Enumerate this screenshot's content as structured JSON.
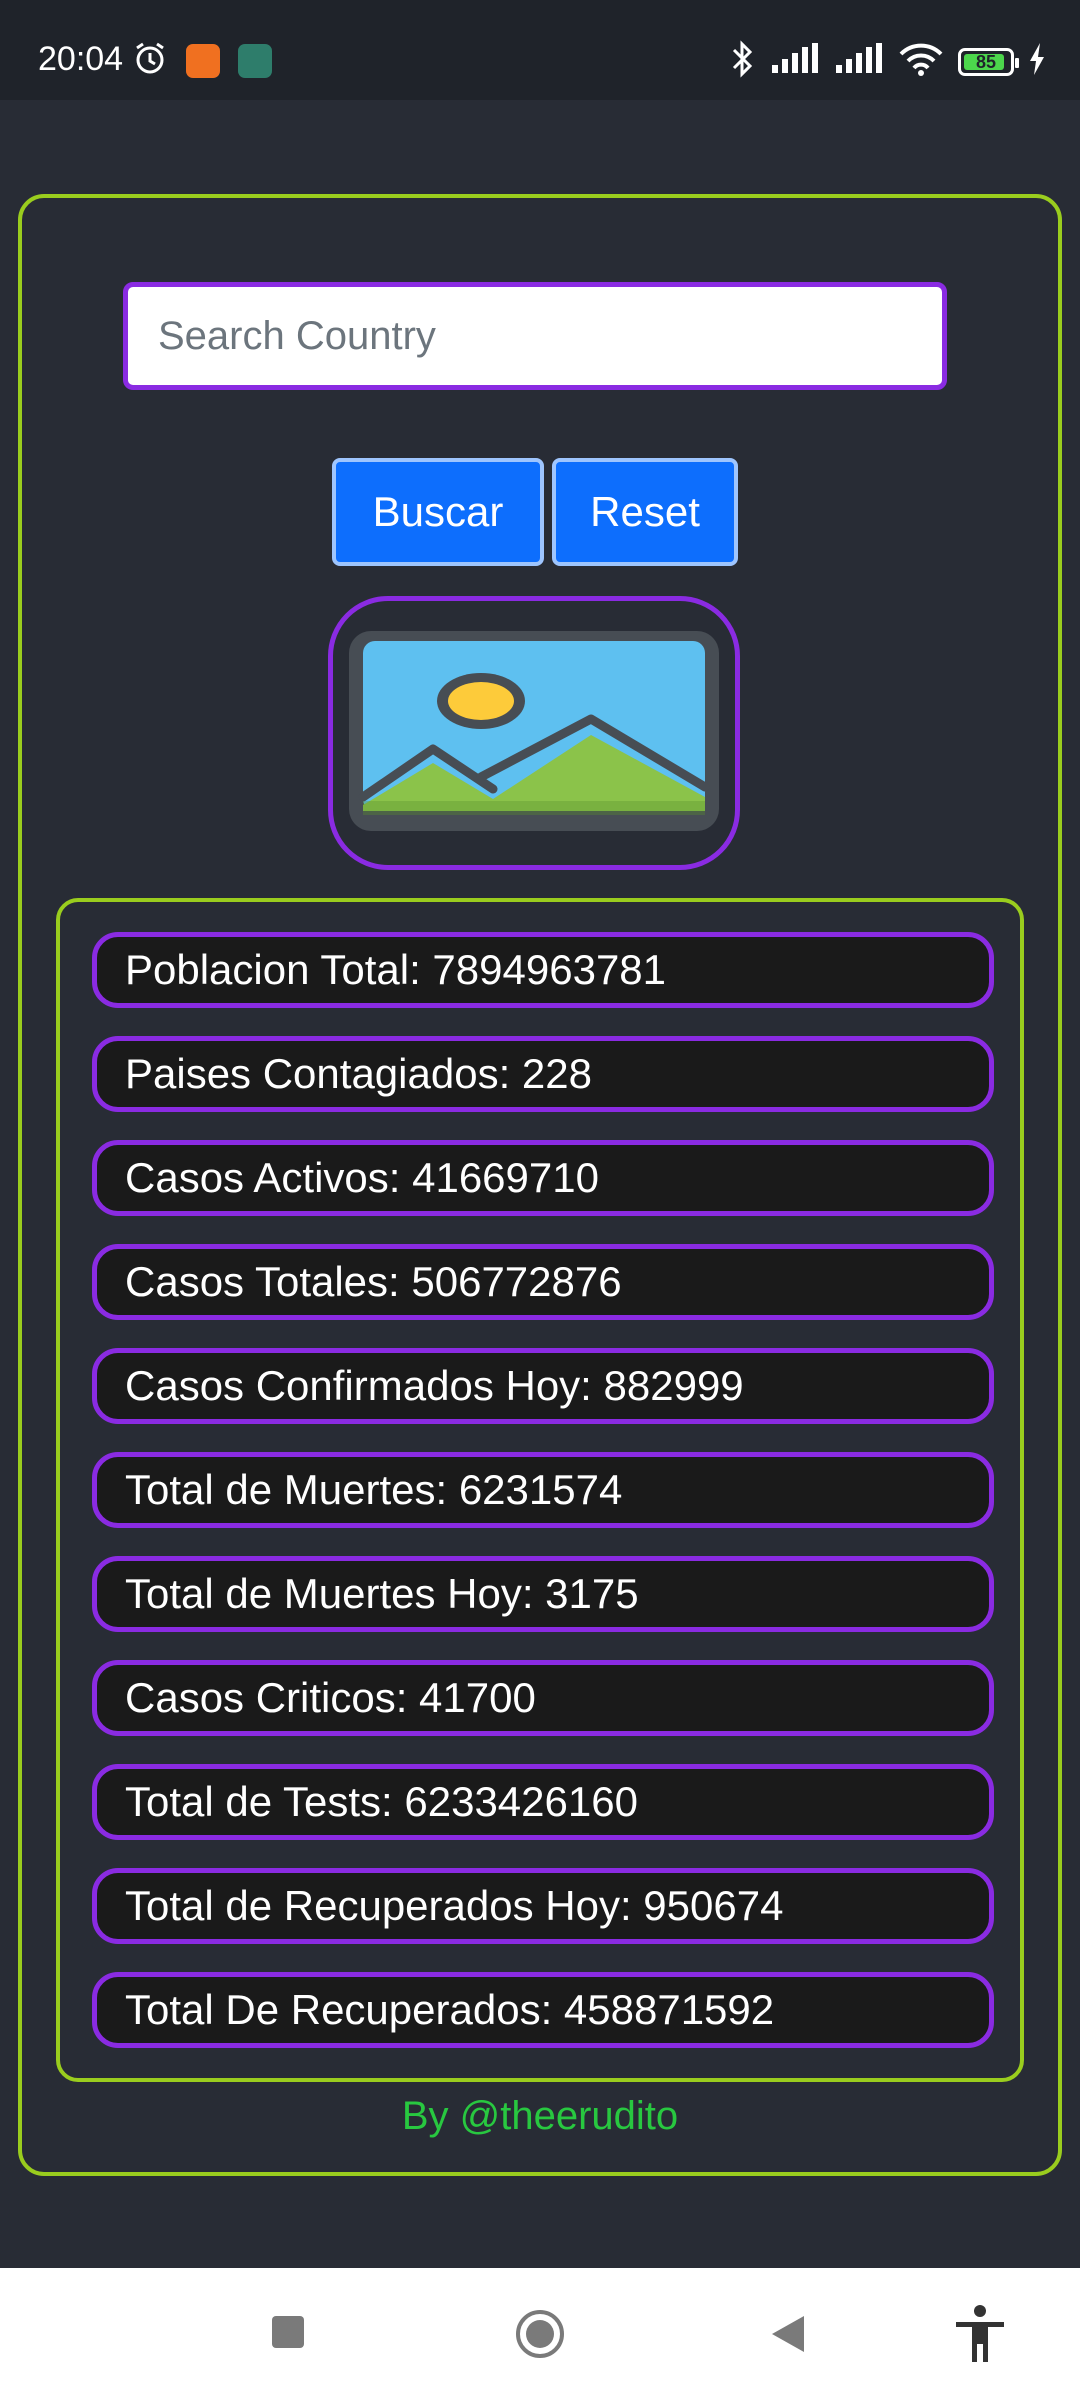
{
  "status_bar": {
    "time": "20:04",
    "battery": "85",
    "left_icons": [
      "alarm-icon",
      "app-orange-icon",
      "app-green-icon"
    ],
    "right_icons": [
      "bluetooth-icon",
      "signal-icon",
      "signal-icon",
      "wifi-icon",
      "battery-icon",
      "charging-icon"
    ]
  },
  "search": {
    "placeholder": "Search Country",
    "value": ""
  },
  "buttons": {
    "buscar": "Buscar",
    "reset": "Reset"
  },
  "flag_image": {
    "icon": "image-placeholder-icon"
  },
  "stats": [
    "Poblacion Total: 7894963781",
    "Paises Contagiados: 228",
    "Casos Activos: 41669710",
    "Casos Totales: 506772876",
    "Casos Confirmados Hoy: 882999",
    "Total de Muertes: 6231574",
    "Total de Muertes Hoy: 3175",
    "Casos Criticos: 41700",
    "Total de Tests: 6233426160",
    "Total de Recuperados Hoy: 950674",
    "Total De Recuperados: 458871592"
  ],
  "credit": "By @theerudito",
  "nav": [
    "recents-icon",
    "home-icon",
    "back-icon",
    "accessibility-icon"
  ],
  "colors": {
    "background": "#282c35",
    "frame_border": "#9acd1e",
    "row_border": "#8a2be2",
    "button": "#0d6efd",
    "credit": "#28c840"
  }
}
